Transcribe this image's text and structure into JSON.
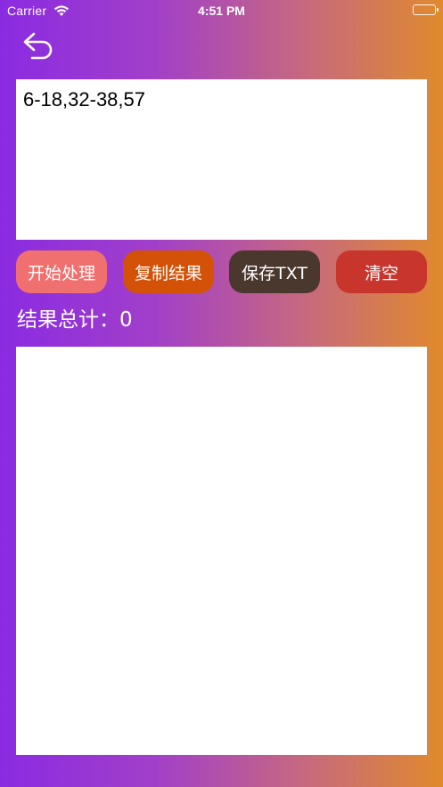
{
  "status_bar": {
    "carrier": "Carrier",
    "time": "4:51 PM",
    "wifi_icon": "wifi-icon",
    "battery_icon": "battery-icon"
  },
  "nav": {
    "back_icon": "back-arrow-icon"
  },
  "input": {
    "value": "6-18,32-38,57"
  },
  "buttons": {
    "start": "开始处理",
    "copy": "复制结果",
    "save": "保存TXT",
    "clear": "清空"
  },
  "result": {
    "label": "结果总计：",
    "count": "0",
    "output": ""
  },
  "colors": {
    "gradient_start": "#8a2be2",
    "gradient_end": "#e08a2d",
    "start_button": "#f07070",
    "copy_button": "#d45208",
    "save_button": "#4a382e",
    "clear_button": "#c7352d"
  }
}
